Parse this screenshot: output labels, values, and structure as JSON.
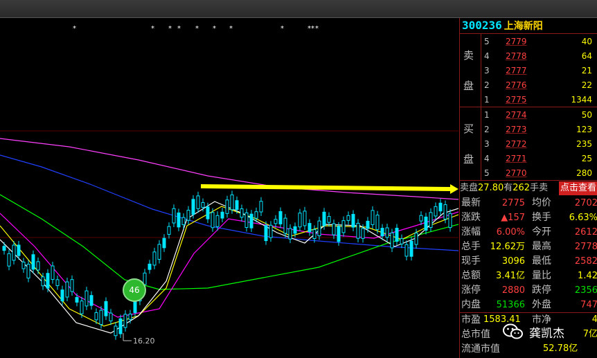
{
  "stock": {
    "code": "300236",
    "name": "上海新阳"
  },
  "orderbook": {
    "sell_label": [
      "卖",
      "盘"
    ],
    "buy_label": [
      "买",
      "盘"
    ],
    "sell": [
      {
        "level": "5",
        "price": "2779",
        "volume": "40"
      },
      {
        "level": "4",
        "price": "2778",
        "volume": "64"
      },
      {
        "level": "3",
        "price": "2777",
        "volume": "21"
      },
      {
        "level": "2",
        "price": "2776",
        "volume": "22"
      },
      {
        "level": "1",
        "price": "2775",
        "volume": "1344"
      }
    ],
    "buy": [
      {
        "level": "1",
        "price": "2774",
        "volume": "50"
      },
      {
        "level": "2",
        "price": "2773",
        "volume": "123"
      },
      {
        "level": "3",
        "price": "2772",
        "volume": "235"
      },
      {
        "level": "4",
        "price": "2771",
        "volume": "25"
      },
      {
        "level": "5",
        "price": "2770",
        "volume": "280"
      }
    ]
  },
  "tip": {
    "prefix": "卖盘",
    "price": "27.80",
    "mid": "有",
    "volume": "262",
    "suffix": "手卖",
    "button": "点击查看"
  },
  "quotes": [
    {
      "l1": "最新",
      "v1": "2775",
      "c1": "red",
      "l2": "均价",
      "v2": "2702",
      "c2": "red"
    },
    {
      "l1": "涨跌",
      "v1": "▲157",
      "c1": "red",
      "l2": "换手",
      "v2": "6.63%",
      "c2": "yel"
    },
    {
      "l1": "涨幅",
      "v1": "6.00%",
      "c1": "red",
      "l2": "今开",
      "v2": "2612",
      "c2": "red"
    },
    {
      "l1": "总手",
      "v1": "12.62万",
      "c1": "yel",
      "l2": "最高",
      "v2": "2778",
      "c2": "red"
    },
    {
      "l1": "现手",
      "v1": "3096",
      "c1": "yel",
      "l2": "最低",
      "v2": "2582",
      "c2": "red"
    },
    {
      "l1": "总额",
      "v1": "3.41亿",
      "c1": "yel",
      "l2": "量比",
      "v2": "1.42",
      "c2": "yel"
    },
    {
      "l1": "涨停",
      "v1": "2880",
      "c1": "red",
      "l2": "跌停",
      "v2": "2356",
      "c2": "grn"
    },
    {
      "l1": "内盘",
      "v1": "51366",
      "c1": "grn",
      "l2": "外盘",
      "v2": "747",
      "c2": "red"
    }
  ],
  "footer": [
    {
      "l1": "市盈",
      "v1": "1583.41",
      "l2": "市净",
      "v2": "4"
    },
    {
      "l1": "总市值",
      "v1": "",
      "l2": "",
      "v2": "7亿"
    },
    {
      "l1": "流通市值",
      "v1": "52.78亿",
      "l2": "",
      "v2": ""
    }
  ],
  "badge": "46",
  "watermark": {
    "text": "龚凯杰",
    "icon": "wechat-icon"
  },
  "chart": {
    "low_label": "16.20",
    "marker": "*",
    "colors": {
      "up": "#00e5ff",
      "down": "#00e5ff",
      "ma5": "#ffffff",
      "ma10": "#ffff00",
      "ma20": "#ff00ff",
      "ma60": "#00ff00",
      "ma120": "#2040ff",
      "ma250": "#ff40ff",
      "arrow": "#ffff00"
    }
  }
}
